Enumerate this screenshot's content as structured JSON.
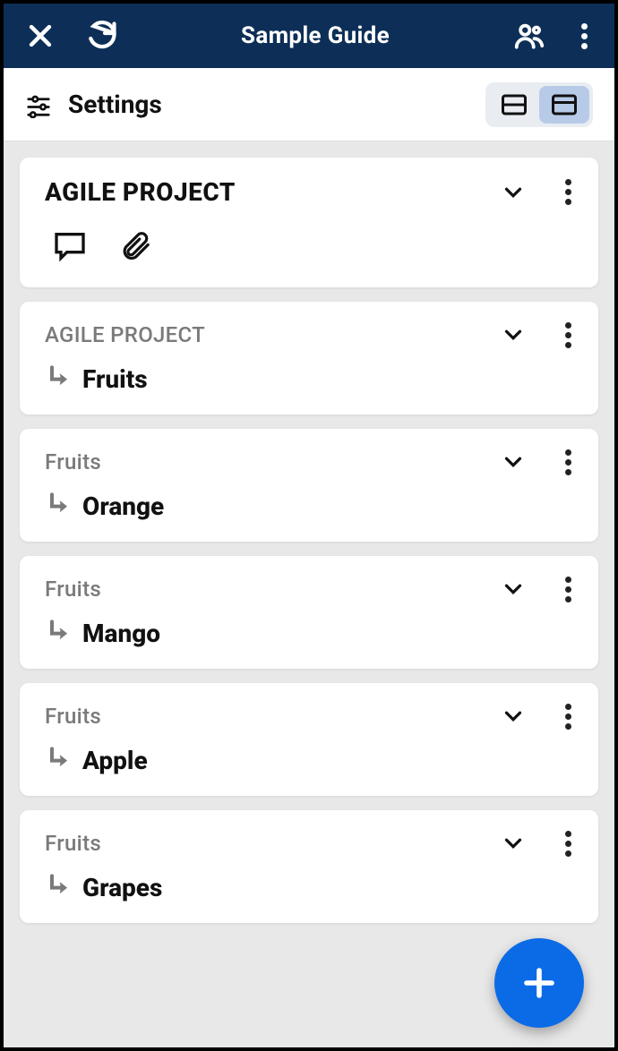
{
  "header": {
    "title": "Sample Guide"
  },
  "subbar": {
    "settings_label": "Settings"
  },
  "cards": [
    {
      "main_title": "AGILE PROJECT"
    },
    {
      "parent": "AGILE PROJECT",
      "child": "Fruits"
    },
    {
      "parent": "Fruits",
      "child": "Orange"
    },
    {
      "parent": "Fruits",
      "child": "Mango"
    },
    {
      "parent": "Fruits",
      "child": "Apple"
    },
    {
      "parent": "Fruits",
      "child": "Grapes"
    }
  ]
}
